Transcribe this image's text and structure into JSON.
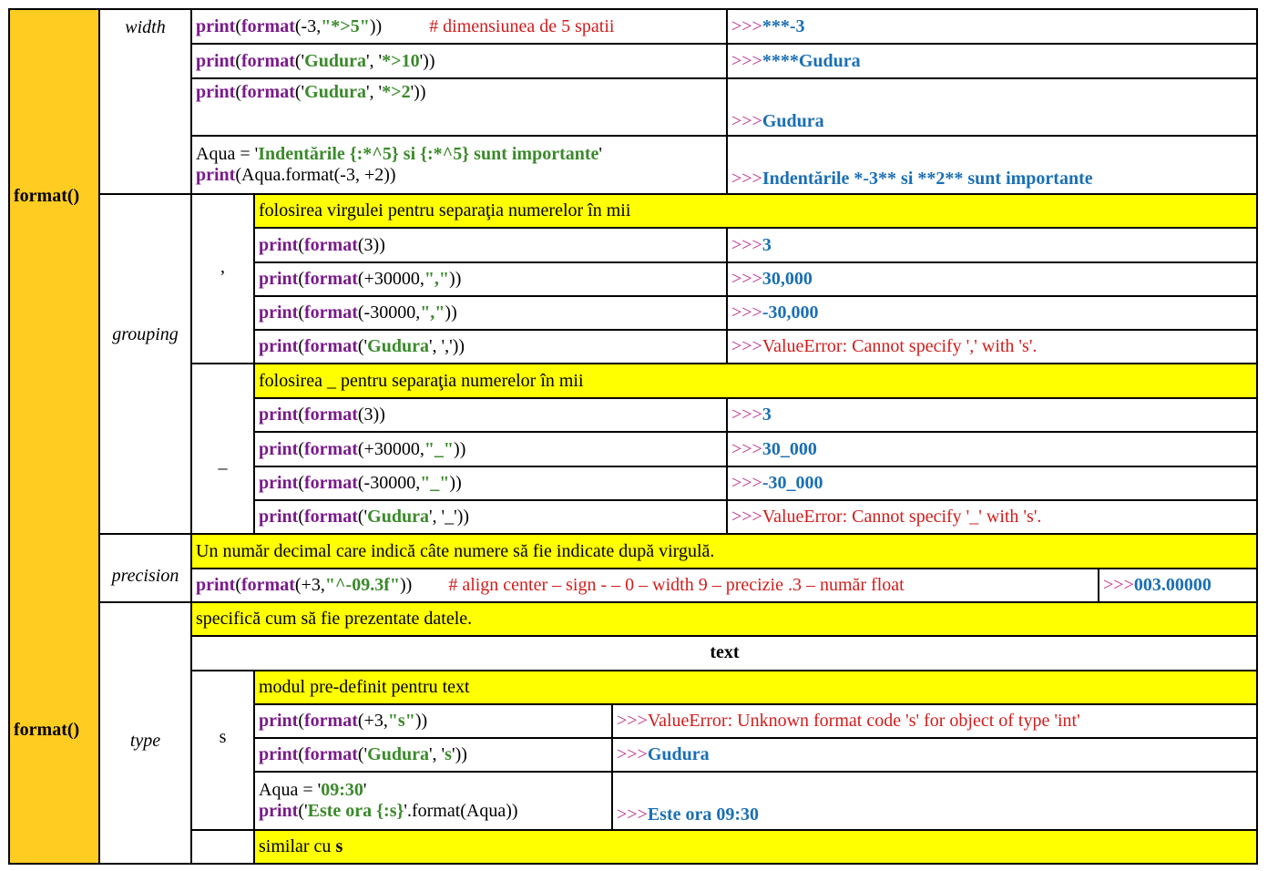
{
  "format_label": "format()",
  "categories": {
    "width": "width",
    "grouping": "grouping",
    "precision": "precision",
    "type": "type"
  },
  "width_rows": [
    {
      "fn1": "print",
      "p1": "(",
      "fn2": "format",
      "p2": "(-3, ",
      "arg": "\"*>5\"",
      "p3": "))",
      "comment": "# dimensiunea de 5 spatii",
      "prompt": ">>>",
      "out": "***-3"
    },
    {
      "fn1": "print",
      "p1": "(",
      "fn2": "format",
      "p2": "('",
      "arg": "Gudura",
      "p3": "', '",
      "arg2": "*>10",
      "p4": "'))",
      "prompt": ">>>",
      "out": "****Gudura"
    },
    {
      "fn1": "print",
      "p1": "(",
      "fn2": "format",
      "p2": "('",
      "arg": "Gudura",
      "p3": "', '",
      "arg2": "*>2",
      "p4": "'))",
      "prompt": ">>>",
      "out": "Gudura"
    },
    {
      "line1_a": "Aqua = '",
      "line1_b": "Indentările {:*^5} si {:*^5} sunt importante",
      "line1_c": "'",
      "fn1": "print",
      "line2": "(Aqua.format(-3, +2))",
      "prompt": ">>>",
      "out": "Indentările *-3** si **2** sunt importante"
    }
  ],
  "grouping": {
    "comma": {
      "symbol": ",",
      "header": "folosirea virgulei pentru separaţia numerelor în mii",
      "rows": [
        {
          "fn1": "print",
          "p1": "(",
          "fn2": "format",
          "p2": "(3))",
          "arg": "",
          "p3": "",
          "prompt": ">>>",
          "out": "3",
          "err": false
        },
        {
          "fn1": "print",
          "p1": "(",
          "fn2": "format",
          "p2": "(+30000, ",
          "arg": "\",\"",
          "p3": "))",
          "prompt": ">>>",
          "out": "30,000",
          "err": false
        },
        {
          "fn1": "print",
          "p1": "(",
          "fn2": "format",
          "p2": "(-30000, ",
          "arg": "\",\"",
          "p3": "))",
          "prompt": ">>>",
          "out": "-30,000",
          "err": false
        },
        {
          "fn1": "print",
          "p1": "(",
          "fn2": "format",
          "p2": "('",
          "arg": "Gudura",
          "p3": "', ',')) ",
          "prompt": ">>>",
          "out": "ValueError: Cannot specify ',' with 's'.",
          "err": true
        }
      ]
    },
    "underscore": {
      "symbol": "_",
      "header": "folosirea _ pentru separaţia numerelor în mii",
      "rows": [
        {
          "fn1": "print",
          "p1": "(",
          "fn2": "format",
          "p2": "(3))",
          "arg": "",
          "p3": "",
          "prompt": ">>>",
          "out": "3",
          "err": false
        },
        {
          "fn1": "print",
          "p1": "(",
          "fn2": "format",
          "p2": "(+30000, ",
          "arg": "\"_\"",
          "p3": "))",
          "prompt": ">>>",
          "out": "30_000",
          "err": false
        },
        {
          "fn1": "print",
          "p1": "(",
          "fn2": "format",
          "p2": "(-30000, ",
          "arg": "\"_\"",
          "p3": "))",
          "prompt": ">>>",
          "out": "-30_000",
          "err": false
        },
        {
          "fn1": "print",
          "p1": "(",
          "fn2": "format",
          "p2": "('",
          "arg": "Gudura",
          "p3": "', '_'))",
          "prompt": ">>>",
          "out": "ValueError: Cannot specify '_' with 's'.",
          "err": true
        }
      ]
    }
  },
  "precision": {
    "header": "Un număr decimal care indică câte numere să fie indicate după virgulă.",
    "row": {
      "fn1": "print",
      "p1": "(",
      "fn2": "format",
      "p2": "(+3, ",
      "arg": "\"^-09.3f\"",
      "p3": "))",
      "comment": "# align center – sign - – 0 – width 9 – precizie .3 – număr float",
      "prompt": ">>>",
      "out": "003.00000"
    }
  },
  "type": {
    "header": "specifică cum să fie prezentate datele.",
    "subheader": "text",
    "s": {
      "symbol": "s",
      "header": "modul pre-definit pentru text",
      "rows": [
        {
          "fn1": "print",
          "p1": "(",
          "fn2": "format",
          "p2": "(+3, ",
          "arg": "\"s\"",
          "p3": "))",
          "prompt": ">>>",
          "out": "ValueError: Unknown format code 's' for object of type 'int'"
        },
        {
          "fn1": "print",
          "p1": "(",
          "fn2": "format",
          "p2": "('",
          "arg": "Gudura",
          "p3": "', '",
          "arg2": "s",
          "p4": "'))",
          "prompt": ">>>",
          "out": "Gudura"
        },
        {
          "line1_a": "Aqua = '",
          "line1_b": "09:30",
          "line1_c": "'",
          "fn1": "print",
          "line2_a": "('",
          "line2_b": "Este ora {:s}",
          "line2_c": "'.format(Aqua))",
          "prompt": ">>>",
          "out": "Este ora 09:30"
        }
      ]
    },
    "similar_prefix": "similar cu ",
    "similar_bold": "s"
  }
}
